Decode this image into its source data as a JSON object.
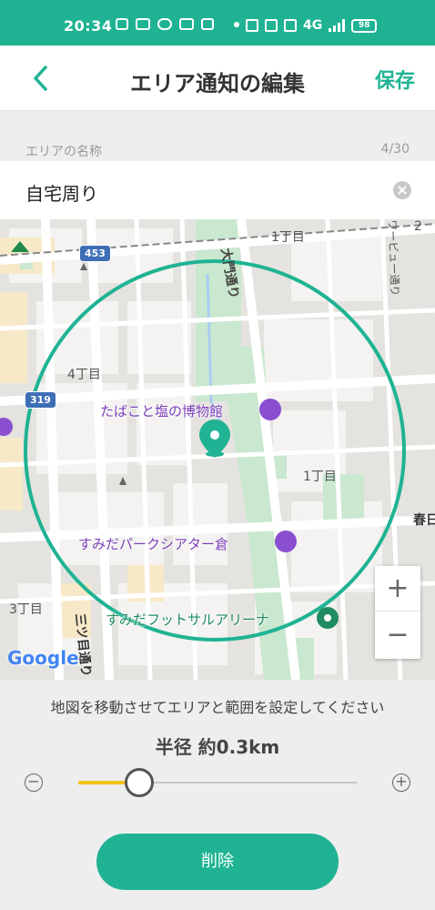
{
  "status_bar": {
    "time": "20:34",
    "network": "4G",
    "battery": "98"
  },
  "header": {
    "title": "エリア通知の編集",
    "save_label": "保存"
  },
  "name_field": {
    "label": "エリアの名称",
    "counter": "4/30",
    "value": "自宅周り"
  },
  "map": {
    "street_labels": [
      "1丁目",
      "2",
      "4丁目",
      "1丁目",
      "3丁目",
      "大門通り",
      "ワービュー通り",
      "春日",
      "三ツ目通り"
    ],
    "route_badges": [
      "453",
      "319"
    ],
    "pois": [
      "たばこと塩の博物館",
      "すみだパークシアター倉",
      "すみだフットサルアリーナ"
    ],
    "google_logo": "Google",
    "zoom_in": "+",
    "zoom_out": "−"
  },
  "controls": {
    "instruction": "地図を移動させてエリアと範囲を設定してください",
    "radius_label": "半径 約0.3km",
    "slider_value": 0.22,
    "minus_label": "−",
    "plus_label": "+",
    "delete_label": "削除"
  },
  "colors": {
    "accent": "#1fb393",
    "slider_fill": "#f3c21a",
    "poi": "#7b3fb8"
  }
}
